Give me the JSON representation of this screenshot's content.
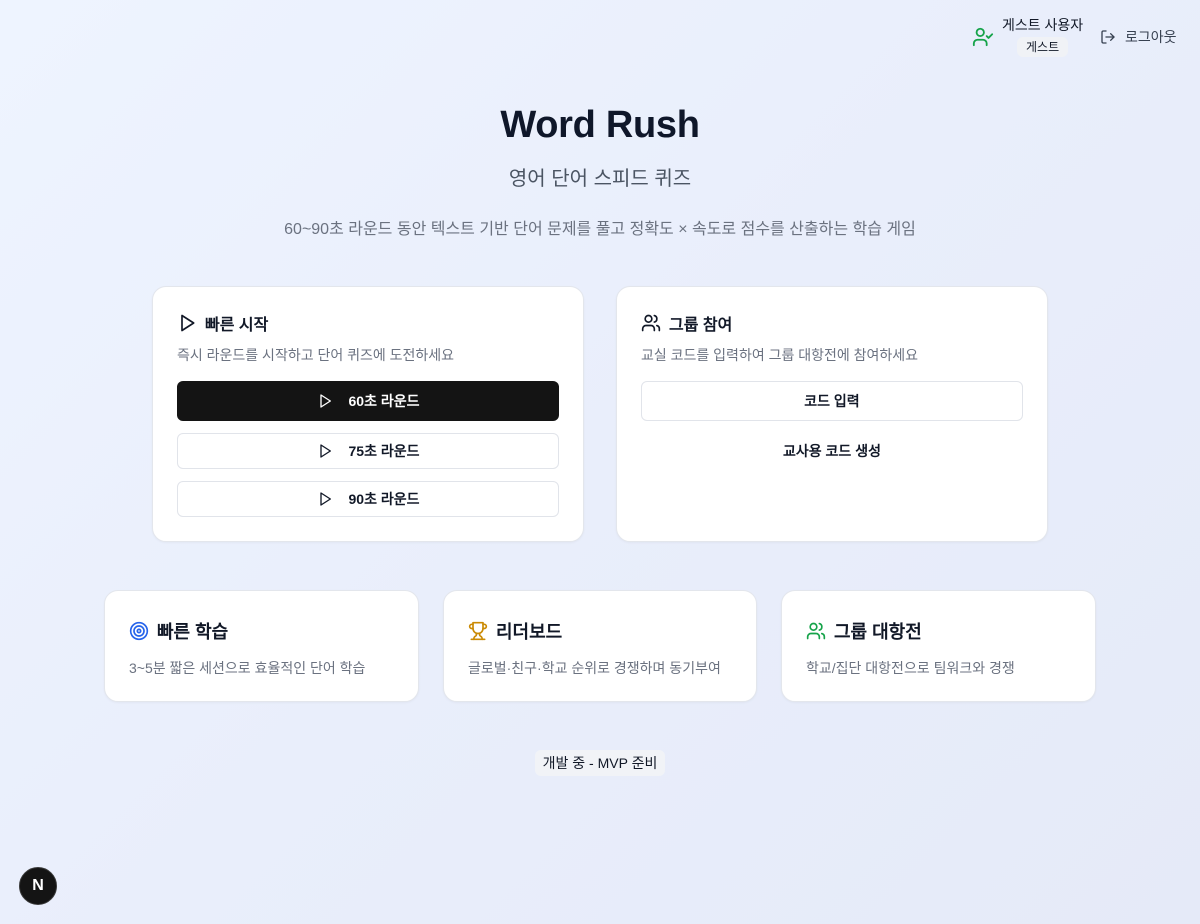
{
  "header": {
    "user_name": "게스트 사용자",
    "user_badge": "게스트",
    "logout_label": "로그아웃"
  },
  "hero": {
    "title": "Word Rush",
    "subtitle": "영어 단어 스피드 퀴즈",
    "description": "60~90초 라운드 동안 텍스트 기반 단어 문제를 풀고 정확도 × 속도로 점수를 산출하는 학습 게임"
  },
  "quick_start": {
    "title": "빠른 시작",
    "description": "즉시 라운드를 시작하고 단어 퀴즈에 도전하세요",
    "buttons": [
      "60초 라운드",
      "75초 라운드",
      "90초 라운드"
    ]
  },
  "group_join": {
    "title": "그룹 참여",
    "description": "교실 코드를 입력하여 그룹 대항전에 참여하세요",
    "code_input_label": "코드 입력",
    "teacher_code_label": "교사용 코드 생성"
  },
  "features": [
    {
      "title": "빠른 학습",
      "description": "3~5분 짧은 세션으로 효율적인 단어 학습",
      "icon": "target-icon",
      "color": "#2563eb"
    },
    {
      "title": "리더보드",
      "description": "글로벌·친구·학교 순위로 경쟁하며 동기부여",
      "icon": "trophy-icon",
      "color": "#ca8a04"
    },
    {
      "title": "그룹 대항전",
      "description": "학교/집단 대항전으로 팀워크와 경쟁",
      "icon": "users-icon",
      "color": "#16a34a"
    }
  ],
  "footer": {
    "status": "개발 중 - MVP 준비",
    "dev_badge": "N"
  }
}
